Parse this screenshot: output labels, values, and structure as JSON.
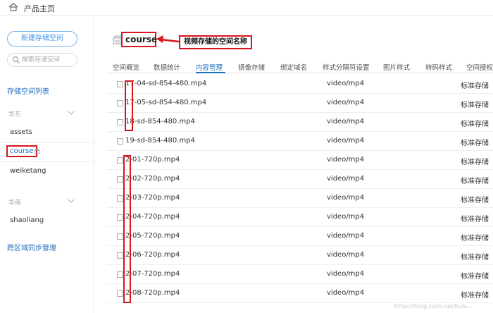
{
  "topbar": {
    "title": "产品主页",
    "icon": "home-icon"
  },
  "sidebar": {
    "new_space_button": "新建存储空间",
    "search_placeholder": "搜索存储空间",
    "heading": "存储空间列表",
    "regions": [
      {
        "label": "华东",
        "items": [
          "assets",
          "course",
          "weiketang"
        ],
        "active": "course"
      },
      {
        "label": "华南",
        "items": [
          "shaoliang"
        ]
      }
    ],
    "sync_link": "跨区域同步管理"
  },
  "main": {
    "bucket_name": "course",
    "annotation": "视频存储的空间名称",
    "tabs": [
      "空间概览",
      "数据统计",
      "内容管理",
      "镜像存储",
      "绑定域名",
      "样式分隔符设置",
      "图片样式",
      "转码样式",
      "空间授权"
    ],
    "active_tab": "内容管理",
    "files": [
      {
        "name": "17-04-sd-854-480.mp4",
        "type": "video/mp4",
        "storage": "标准存储"
      },
      {
        "name": "17-05-sd-854-480.mp4",
        "type": "video/mp4",
        "storage": "标准存储"
      },
      {
        "name": "18-sd-854-480.mp4",
        "type": "video/mp4",
        "storage": "标准存储"
      },
      {
        "name": "19-sd-854-480.mp4",
        "type": "video/mp4",
        "storage": "标准存储"
      },
      {
        "name": "2-01-720p.mp4",
        "type": "video/mp4",
        "storage": "标准存储"
      },
      {
        "name": "2-02-720p.mp4",
        "type": "video/mp4",
        "storage": "标准存储"
      },
      {
        "name": "2-03-720p.mp4",
        "type": "video/mp4",
        "storage": "标准存储"
      },
      {
        "name": "2-04-720p.mp4",
        "type": "video/mp4",
        "storage": "标准存储"
      },
      {
        "name": "2-05-720p.mp4",
        "type": "video/mp4",
        "storage": "标准存储"
      },
      {
        "name": "2-06-720p.mp4",
        "type": "video/mp4",
        "storage": "标准存储"
      },
      {
        "name": "2-07-720p.mp4",
        "type": "video/mp4",
        "storage": "标准存储"
      },
      {
        "name": "2-08-720p.mp4",
        "type": "video/mp4",
        "storage": "标准存储"
      }
    ]
  },
  "watermark": "https://blog.csdn.net/bulu...",
  "colors": {
    "accent": "#1f6fbf",
    "annotation_red": "#d8141c",
    "button_border": "#6fb0f0"
  }
}
